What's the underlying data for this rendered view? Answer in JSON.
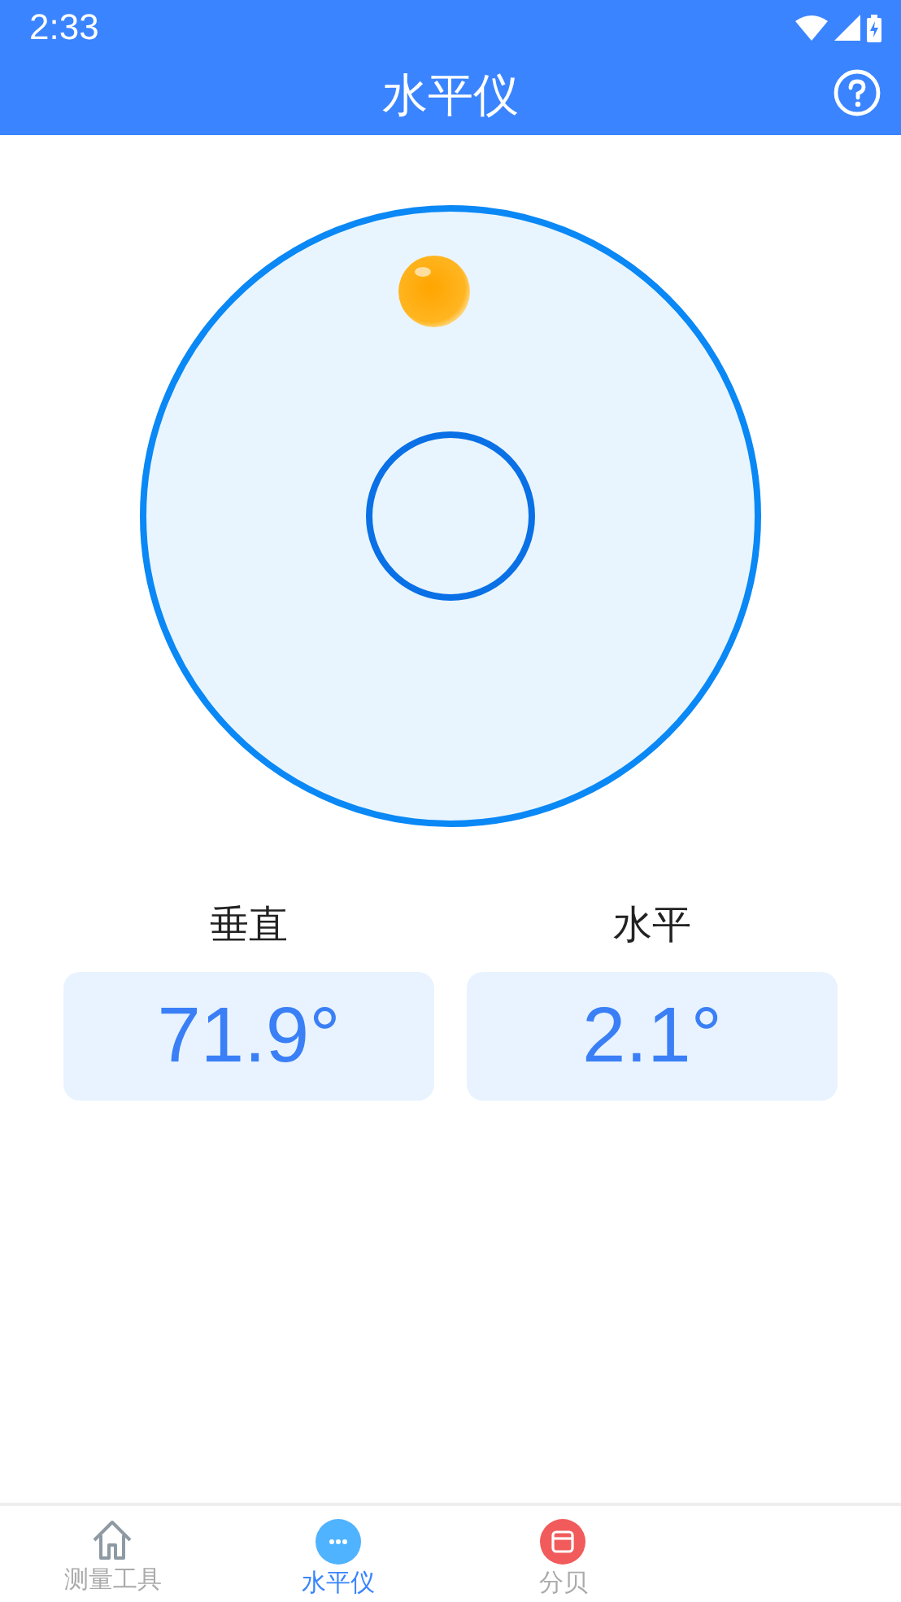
{
  "status_bar": {
    "time": "2:33"
  },
  "app_bar": {
    "title": "水平仪"
  },
  "readings": [
    {
      "label": "垂直",
      "value": "71.9°"
    },
    {
      "label": "水平",
      "value": "2.1°"
    }
  ],
  "bottom_nav": [
    {
      "label": "测量工具",
      "kind": "home",
      "selected": false
    },
    {
      "label": "水平仪",
      "kind": "level",
      "selected": true
    },
    {
      "label": "分贝",
      "kind": "decibel",
      "selected": false
    }
  ]
}
